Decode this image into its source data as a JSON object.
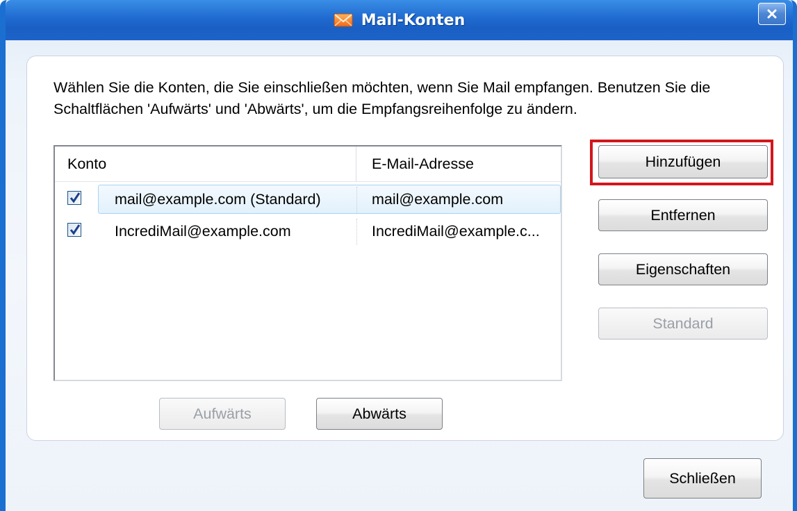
{
  "window": {
    "title": "Mail-Konten",
    "accent_color": "#1b6fd0",
    "title_icon": "envelope-icon",
    "close_icon": "close-icon"
  },
  "instructions": "Wählen Sie die Konten, die Sie einschließen möchten, wenn Sie Mail empfangen. Benutzen Sie die Schaltflächen 'Aufwärts' und 'Abwärts', um die Empfangsreihenfolge zu ändern.",
  "accounts_list": {
    "columns": [
      "Konto",
      "E-Mail-Adresse"
    ],
    "rows": [
      {
        "checked": true,
        "selected": true,
        "account": "mail@example.com (Standard)",
        "email": "mail@example.com"
      },
      {
        "checked": true,
        "selected": false,
        "account": "IncrediMail@example.com",
        "email": "IncrediMail@example.c..."
      }
    ]
  },
  "side_buttons": {
    "add": "Hinzufügen",
    "remove": "Entfernen",
    "properties": "Eigenschaften",
    "set_default": "Standard"
  },
  "order_buttons": {
    "up": "Aufwärts",
    "down": "Abwärts"
  },
  "footer": {
    "close": "Schließen"
  },
  "annotation": {
    "highlight_color": "#d3161d",
    "highlighted": "Hinzufügen"
  }
}
